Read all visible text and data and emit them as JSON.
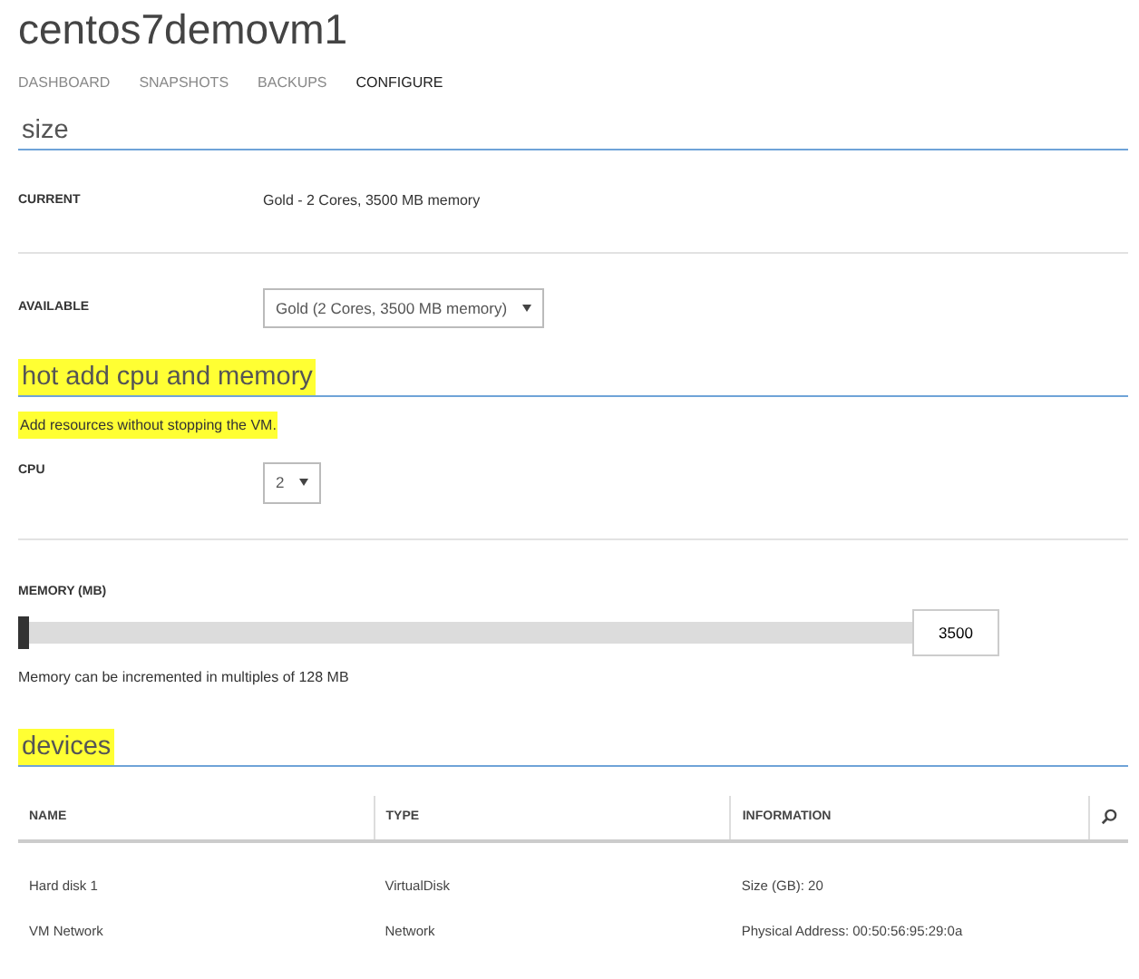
{
  "title": "centos7demovm1",
  "tabs": [
    {
      "label": "DASHBOARD",
      "selected": false
    },
    {
      "label": "SNAPSHOTS",
      "selected": false
    },
    {
      "label": "BACKUPS",
      "selected": false
    },
    {
      "label": "CONFIGURE",
      "selected": true
    }
  ],
  "size": {
    "heading": "size",
    "highlighted": false,
    "current_label": "CURRENT",
    "current_value": "Gold - 2 Cores, 3500 MB memory",
    "available_label": "AVAILABLE",
    "available_value": "Gold (2 Cores, 3500 MB memory)"
  },
  "hot_add": {
    "heading": "hot add cpu and memory",
    "highlighted": true,
    "description": "Add resources without stopping the VM.",
    "description_highlighted": true,
    "cpu_label": "CPU",
    "cpu_value": "2",
    "memory_label": "MEMORY (MB)",
    "memory_slider": {
      "level": 0
    },
    "memory_value": "3500",
    "note": "Memory can be incremented in multiples of 128 MB"
  },
  "devices": {
    "heading": "devices",
    "highlighted": true,
    "columns": [
      "NAME",
      "TYPE",
      "INFORMATION"
    ],
    "rows": [
      [
        "Hard disk 1",
        "VirtualDisk",
        "Size (GB): 20"
      ],
      [
        "VM Network",
        "Network",
        "Physical Address: 00:50:56:95:29:0a"
      ]
    ]
  }
}
